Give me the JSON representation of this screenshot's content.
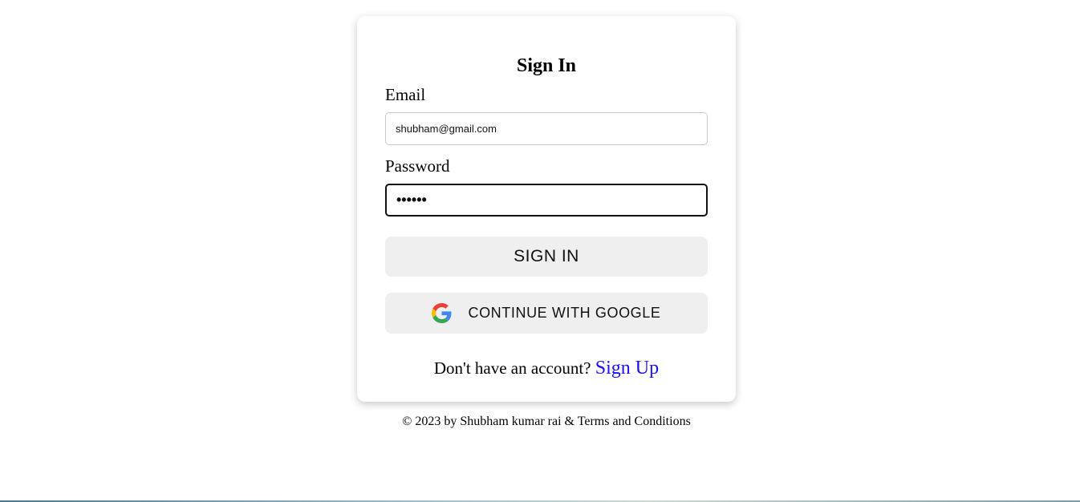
{
  "signin_card": {
    "title": "Sign In",
    "email_label": "Email",
    "email_value": "shubham@gmail.com",
    "password_label": "Password",
    "password_value": "••••••",
    "signin_button": "SIGN IN",
    "google_button": "CONTINUE WITH GOOGLE",
    "google_icon": "google-g-icon",
    "signup_prompt": "Don't have an account?",
    "signup_link": "Sign Up"
  },
  "footer": {
    "text": "© 2023 by Shubham kumar rai & Terms and Conditions"
  },
  "colors": {
    "link": "#1a0dff",
    "button_bg": "#efefef",
    "card_bg": "#ffffff"
  }
}
